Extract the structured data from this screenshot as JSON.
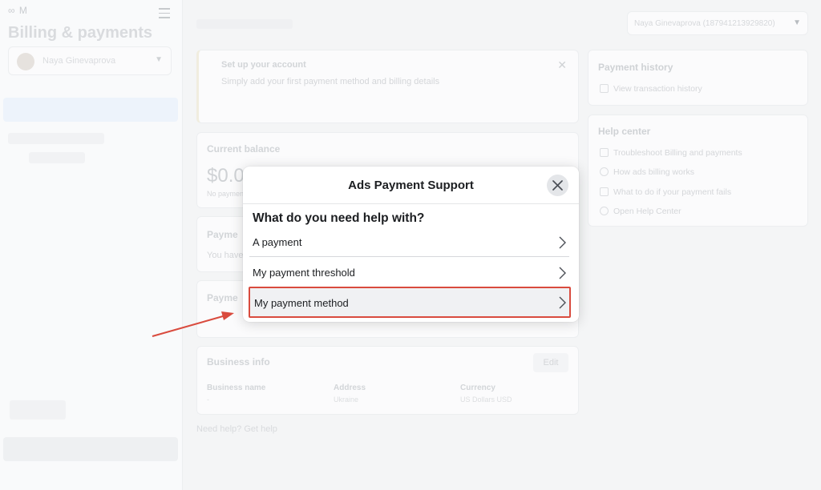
{
  "sidebar": {
    "title": "Billing & payments",
    "account_name": "Naya Ginevaprova"
  },
  "header": {
    "account_dropdown": "Naya Ginevaprova (187941213929820)"
  },
  "setup_card": {
    "title": "Set up your account",
    "text": "Simply add your first payment method and billing details"
  },
  "balance_card": {
    "title": "Current balance",
    "amount": "$0.0",
    "note": "No payment"
  },
  "payments_card": {
    "title": "Payme",
    "text": "You have"
  },
  "payment_methods_card": {
    "title": "Payme"
  },
  "business_info": {
    "title": "Business info",
    "edit_label": "Edit",
    "fields": [
      {
        "label": "Business name",
        "value": "-"
      },
      {
        "label": "Address",
        "value": "Ukraine"
      },
      {
        "label": "Currency",
        "value": "US Dollars USD"
      }
    ]
  },
  "need_help": "Need help? Get help",
  "payment_history": {
    "title": "Payment history",
    "link": "View transaction history"
  },
  "help_center": {
    "title": "Help center",
    "items": [
      "Troubleshoot Billing and payments",
      "How ads billing works",
      "What to do if your payment fails",
      "Open Help Center"
    ]
  },
  "modal": {
    "title": "Ads Payment Support",
    "question": "What do you need help with?",
    "options": [
      "A payment",
      "My payment threshold",
      "My payment method"
    ]
  },
  "colors": {
    "highlight": "#d94b3e",
    "annotation_arrow": "#d94b3e"
  }
}
